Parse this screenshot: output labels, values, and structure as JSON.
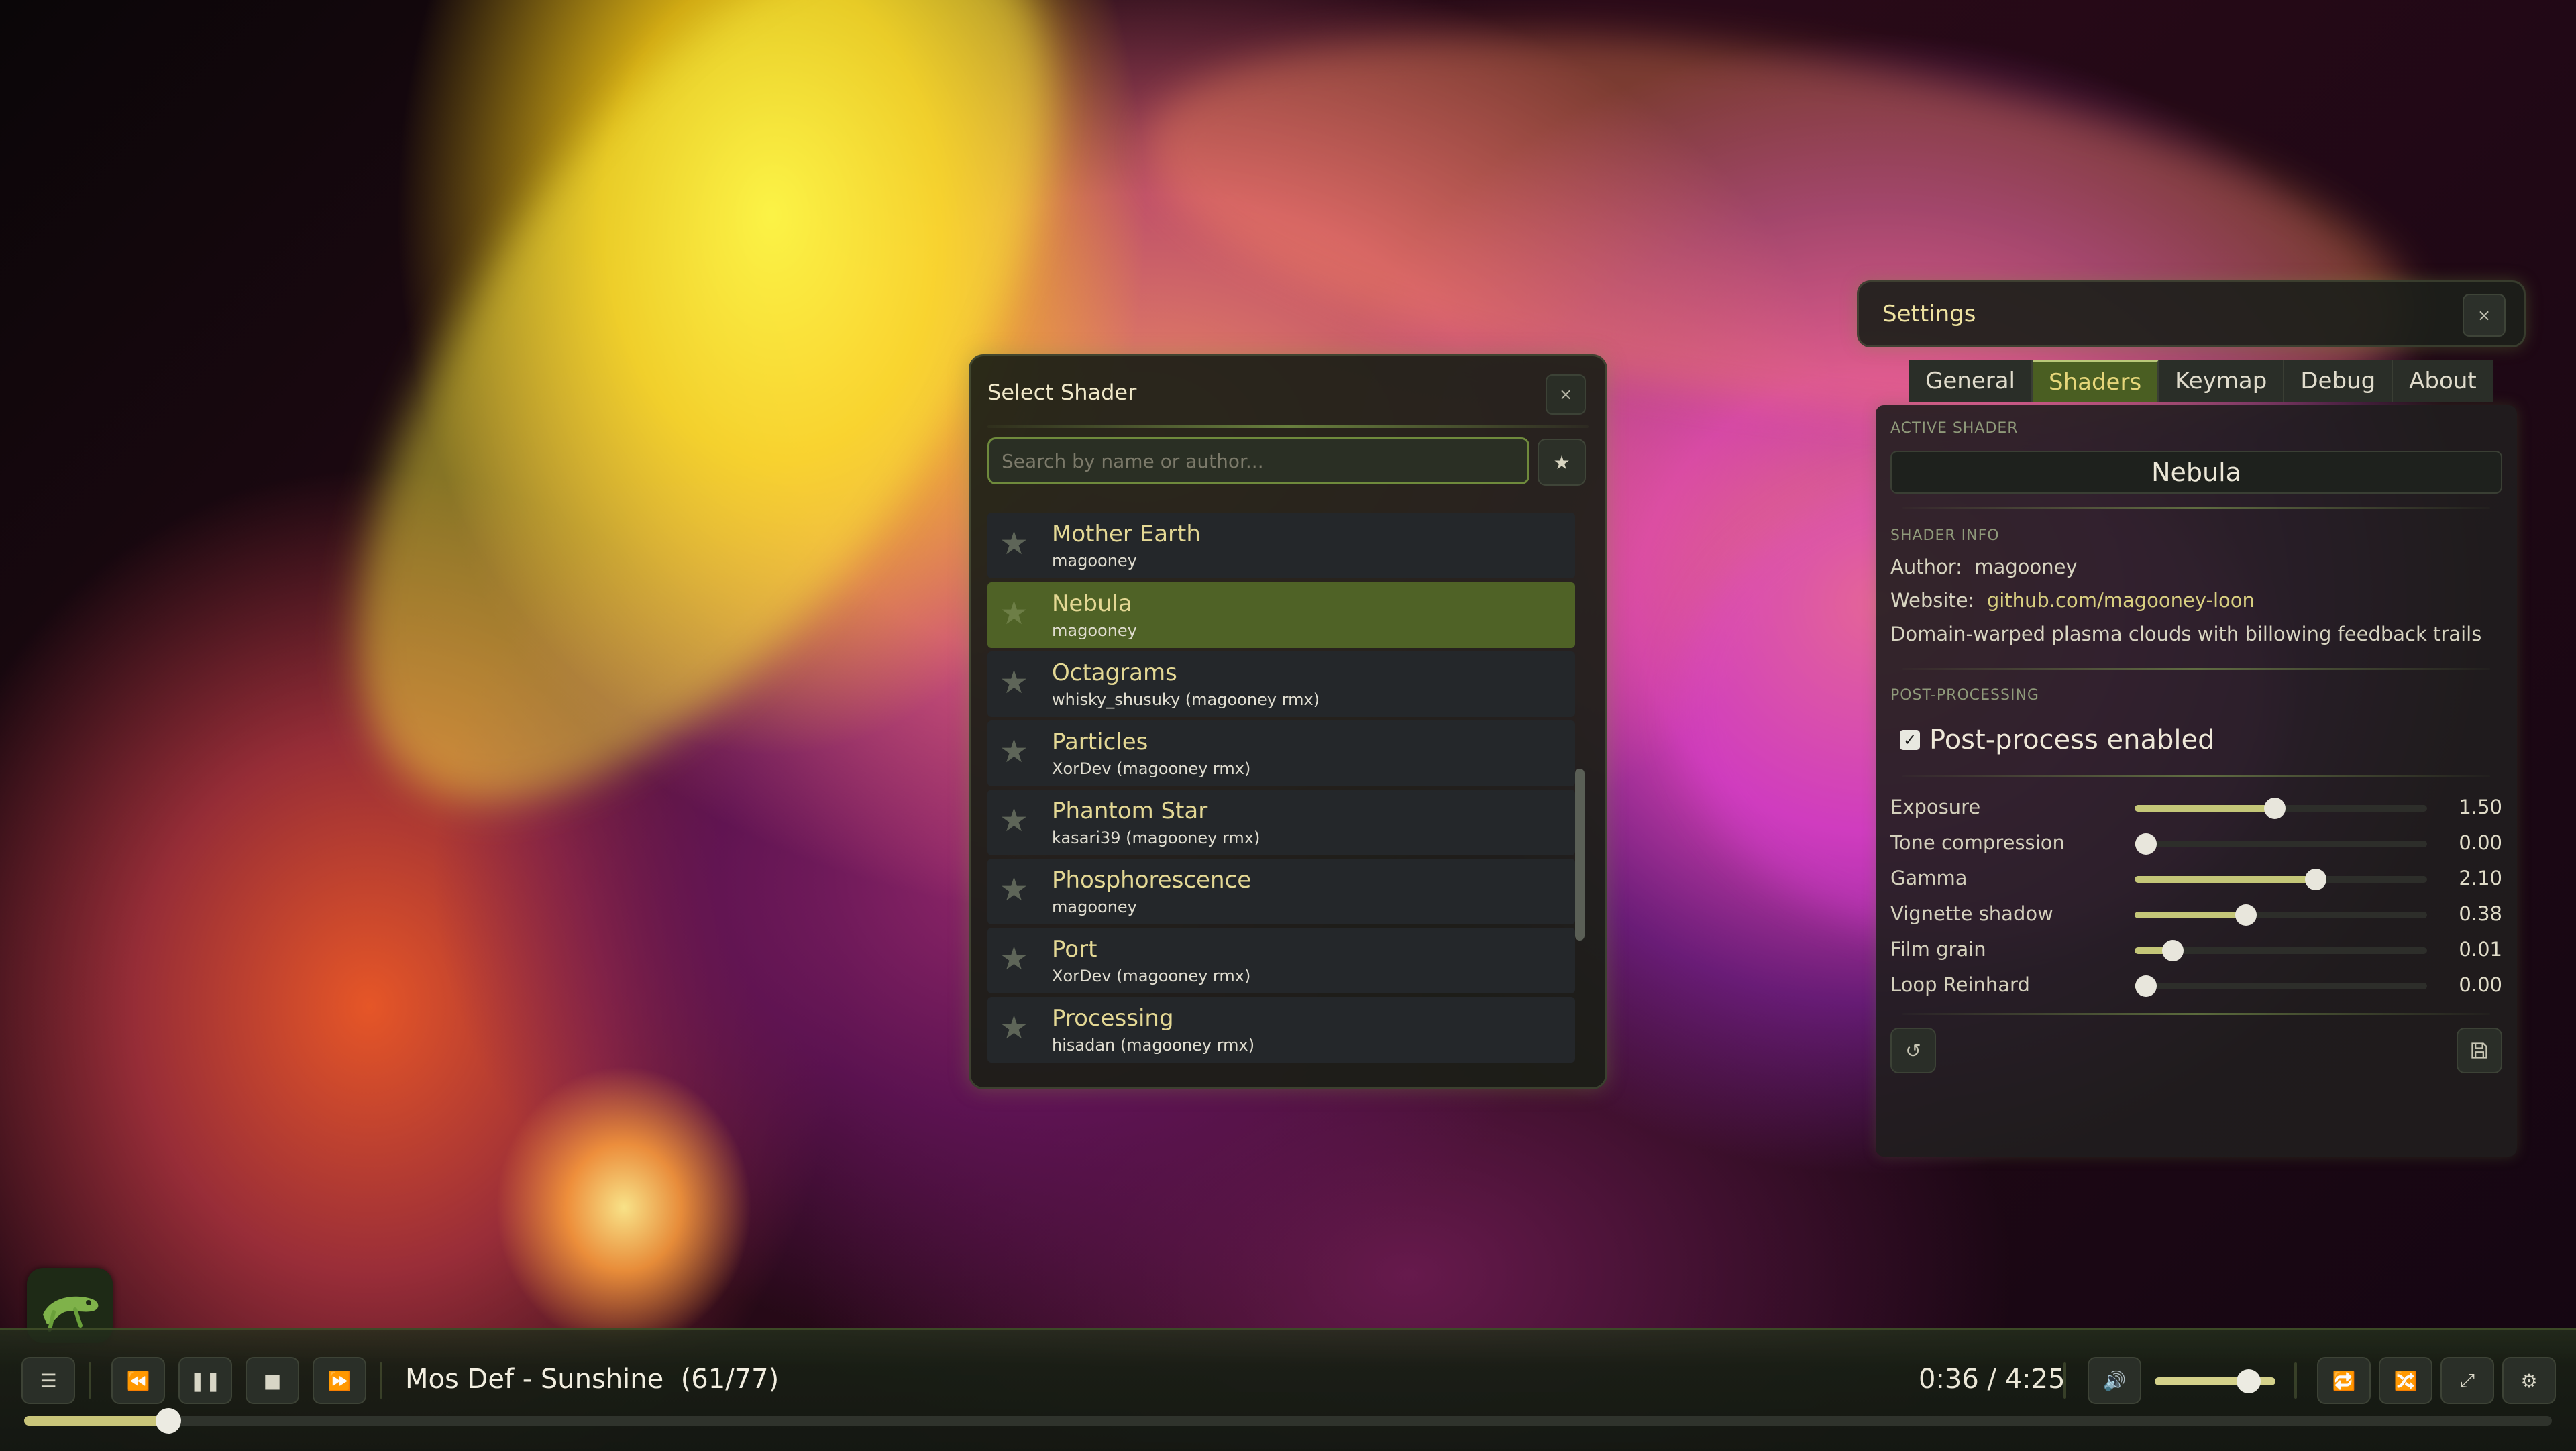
{
  "shader_picker": {
    "title": "Select Shader",
    "close_label": "×",
    "search_placeholder": "Search by name or author...",
    "favorite_filter_icon": "star-icon",
    "items": [
      {
        "name": "Mother Earth",
        "author": "magooney",
        "active": false
      },
      {
        "name": "Nebula",
        "author": "magooney",
        "active": true
      },
      {
        "name": "Octagrams",
        "author": "whisky_shusuky (magooney rmx)",
        "active": false
      },
      {
        "name": "Particles",
        "author": "XorDev (magooney rmx)",
        "active": false
      },
      {
        "name": "Phantom Star",
        "author": "kasari39 (magooney rmx)",
        "active": false
      },
      {
        "name": "Phosphorescence",
        "author": "magooney",
        "active": false
      },
      {
        "name": "Port",
        "author": "XorDev (magooney rmx)",
        "active": false
      },
      {
        "name": "Processing",
        "author": "hisadan (magooney rmx)",
        "active": false
      }
    ]
  },
  "settings": {
    "title": "Settings",
    "close_label": "×",
    "tabs": [
      {
        "label": "General",
        "active": false
      },
      {
        "label": "Shaders",
        "active": true
      },
      {
        "label": "Keymap",
        "active": false
      },
      {
        "label": "Debug",
        "active": false
      },
      {
        "label": "About",
        "active": false
      }
    ],
    "active_shader_label": "ACTIVE SHADER",
    "active_shader": "Nebula",
    "shader_info_label": "SHADER INFO",
    "author_label": "Author:",
    "author_value": "magooney",
    "website_label": "Website:",
    "website_value": "github.com/magooney-loon",
    "description": "Domain-warped plasma clouds with billowing feedback trails",
    "post_processing_label": "POST-PROCESSING",
    "post_process_enabled_label": "Post-process enabled",
    "post_process_enabled": true,
    "sliders": [
      {
        "label": "Exposure",
        "value": "1.50",
        "fraction": 0.48
      },
      {
        "label": "Tone compression",
        "value": "0.00",
        "fraction": 0.04
      },
      {
        "label": "Gamma",
        "value": "2.10",
        "fraction": 0.62
      },
      {
        "label": "Vignette shadow",
        "value": "0.38",
        "fraction": 0.38
      },
      {
        "label": "Film grain",
        "value": "0.01",
        "fraction": 0.13
      },
      {
        "label": "Loop Reinhard",
        "value": "0.00",
        "fraction": 0.04
      }
    ],
    "reset_icon": "reset-icon",
    "save_icon": "save-icon"
  },
  "player": {
    "track": "Mos Def - Sunshine",
    "position": "(61/77)",
    "time": "0:36 / 4:25",
    "progress_fraction": 0.057,
    "volume_fraction": 0.78,
    "icons": [
      "playlist-icon",
      "rewind-icon",
      "pause-icon",
      "stop-icon",
      "fast-forward-icon",
      "volume-icon",
      "repeat-icon",
      "shuffle-icon",
      "fullscreen-icon",
      "settings-gear-icon"
    ]
  },
  "colors": {
    "accent": "#4f6226",
    "accent_text": "#e4d894",
    "panel_bg": "#24272a"
  }
}
